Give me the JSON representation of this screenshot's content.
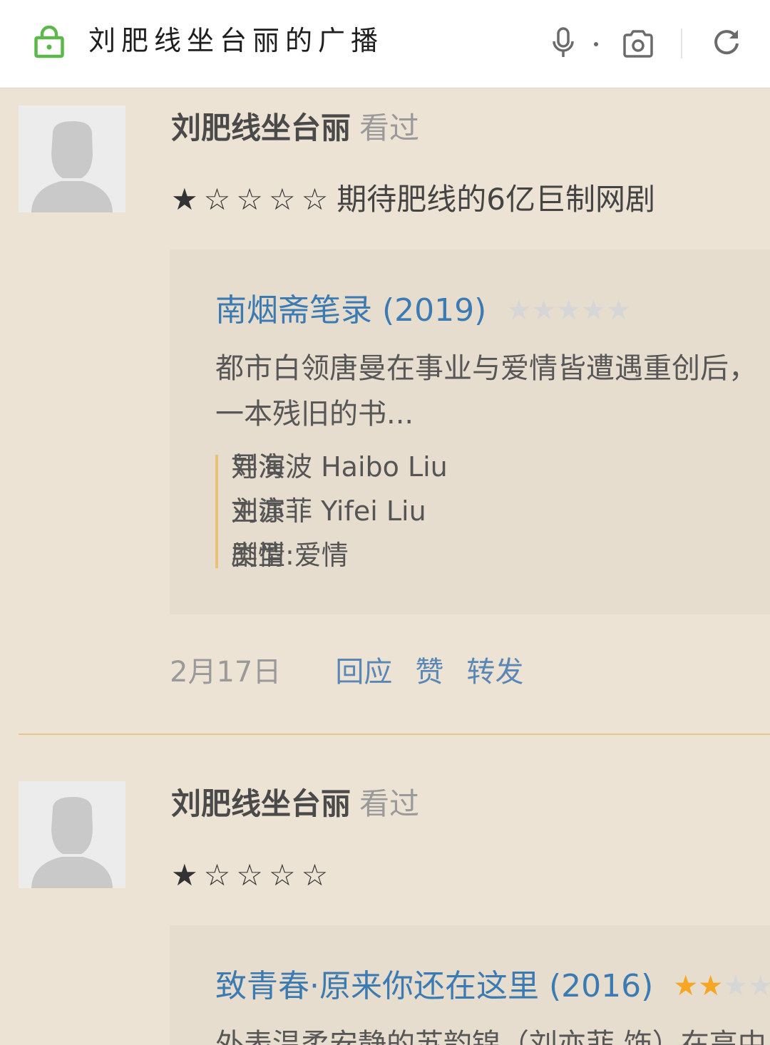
{
  "browser": {
    "page_title": "刘肥线坐台丽的广播",
    "icons": [
      "lock-icon",
      "mic-icon",
      "camera-icon",
      "refresh-icon"
    ]
  },
  "colors": {
    "background": "#ece3d5",
    "card": "#e6ddcf",
    "title_blue": "#3c7bb2",
    "link": "#5a87b5",
    "star_on": "#f5a623",
    "star_off": "#d6d6d6",
    "secure_green": "#5cb84a",
    "divider": "#e9c58e",
    "info_bar": "#e8c07c"
  },
  "posts": [
    {
      "user": {
        "name": "刘肥线坐台丽",
        "action": "看过"
      },
      "rating_text": "★☆☆☆☆",
      "comment": "期待肥线的6亿巨制网剧",
      "card": {
        "title": "南烟斋笔录 (2019)",
        "stars_filled": 0,
        "stars_total": 5,
        "description": [
          "都市白领唐曼在事业与爱情皆遭遇重创后，",
          "一本残旧的书..."
        ],
        "info": [
          {
            "label": "导演",
            "value": "刘海波 Haibo Liu"
          },
          {
            "label": "主演",
            "value": "刘亦菲 Yifei Liu"
          },
          {
            "label": "类型",
            "value": "剧情:爱情"
          }
        ]
      },
      "footer": {
        "date": "2月17日",
        "actions": [
          "回应",
          "赞",
          "转发"
        ]
      }
    },
    {
      "user": {
        "name": "刘肥线坐台丽",
        "action": "看过"
      },
      "rating_text": "★☆☆☆☆",
      "card": {
        "title": "致青春·原来你还在这里 (2016)",
        "stars_filled": 2,
        "stars_total": 5,
        "description": [
          "外表温柔安静的苏韵锦（刘亦菲 饰）在高中"
        ]
      }
    }
  ]
}
